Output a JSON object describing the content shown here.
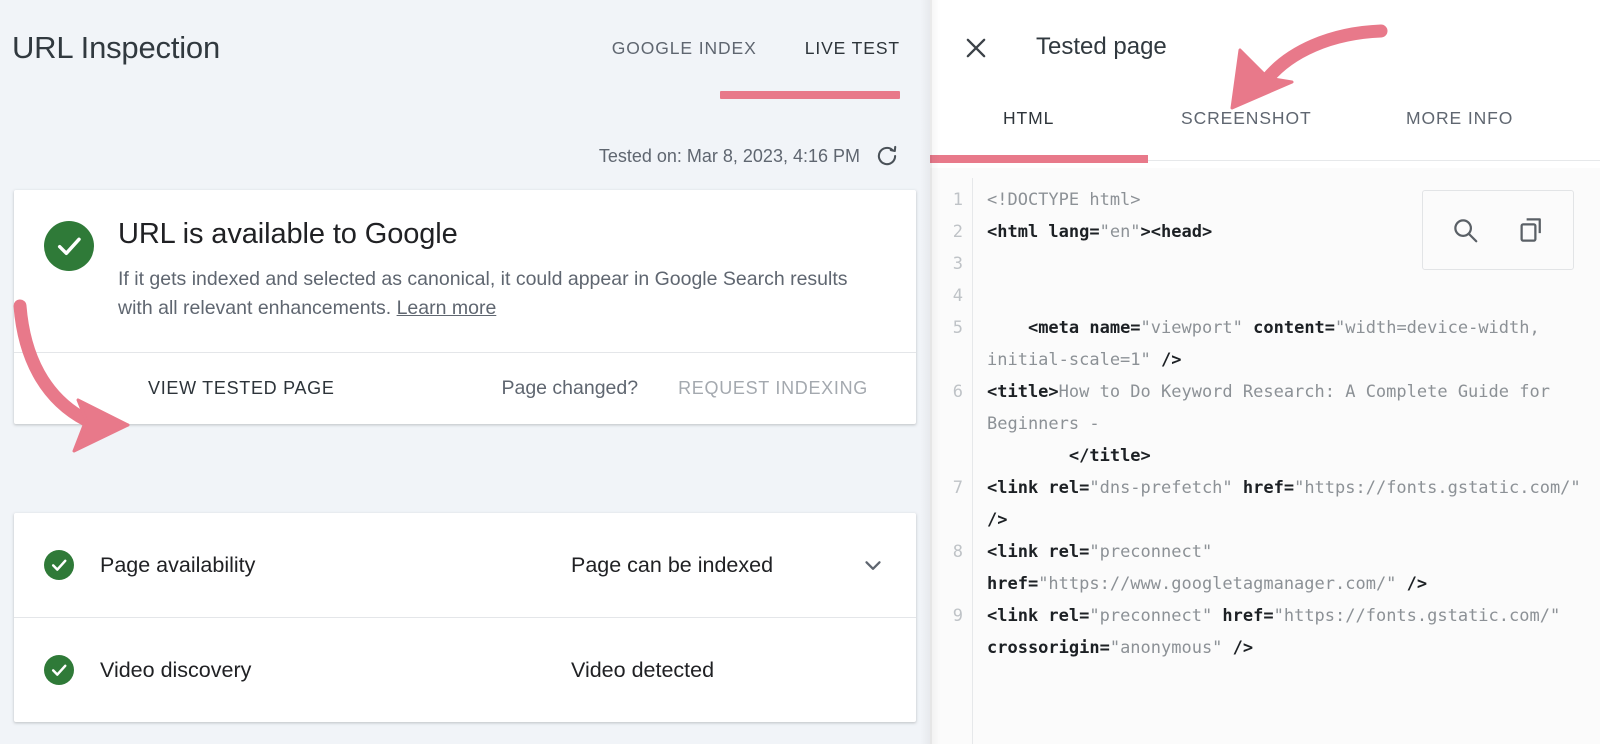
{
  "left": {
    "page_title": "URL Inspection",
    "tabs": [
      {
        "label": "GOOGLE INDEX",
        "active": false
      },
      {
        "label": "LIVE TEST",
        "active": true
      }
    ],
    "tested_on": "Tested on: Mar 8, 2023, 4:16 PM",
    "refresh_icon": "refresh-icon",
    "status_card": {
      "icon": "check-circle-icon",
      "title": "URL is available to Google",
      "description": "If it gets indexed and selected as canonical, it could appear in Google Search results with all relevant enhancements.",
      "learn_more": "Learn more",
      "view_tested_page": "VIEW TESTED PAGE",
      "page_changed": "Page changed?",
      "request_indexing": "REQUEST INDEXING"
    },
    "checks": [
      {
        "icon": "check-circle-icon",
        "label": "Page availability",
        "value": "Page can be indexed",
        "has_chevron": true,
        "chevron_icon": "chevron-down-icon"
      },
      {
        "icon": "check-circle-icon",
        "label": "Video discovery",
        "value": "Video detected",
        "has_chevron": false,
        "chevron_icon": ""
      }
    ]
  },
  "right": {
    "close_icon": "close-icon",
    "title": "Tested page",
    "tabs": [
      {
        "label": "HTML",
        "active": true
      },
      {
        "label": "SCREENSHOT",
        "active": false
      },
      {
        "label": "MORE INFO",
        "active": false
      }
    ],
    "tools": [
      {
        "icon": "search-icon"
      },
      {
        "icon": "copy-icon"
      }
    ],
    "line_numbers": [
      "1",
      "2",
      "3",
      "4",
      "5",
      "6",
      "7",
      "8",
      "9"
    ],
    "code_lines": [
      {
        "n": "1",
        "segments": [
          {
            "t": "plain",
            "s": "<!DOCTYPE html>"
          }
        ]
      },
      {
        "n": "2",
        "segments": [
          {
            "t": "tag",
            "s": "<html lang="
          },
          {
            "t": "plain",
            "s": "\"en\""
          },
          {
            "t": "tag",
            "s": "><head>"
          }
        ]
      },
      {
        "n": "3",
        "segments": [
          {
            "t": "plain",
            "s": ""
          }
        ]
      },
      {
        "n": "4",
        "segments": [
          {
            "t": "plain",
            "s": ""
          }
        ]
      },
      {
        "n": "5",
        "segments": [
          {
            "t": "tag",
            "s": "    <meta name="
          },
          {
            "t": "plain",
            "s": "\"viewport\" "
          },
          {
            "t": "tag",
            "s": "content="
          },
          {
            "t": "plain",
            "s": "\"width=device-width, initial-scale=1\" "
          },
          {
            "t": "tag",
            "s": "/>"
          }
        ]
      },
      {
        "n": "6",
        "segments": [
          {
            "t": "tag",
            "s": "<title>"
          },
          {
            "t": "plain",
            "s": "How to Do Keyword Research: A Complete Guide for Beginners -\n        "
          },
          {
            "t": "tag",
            "s": "</title>"
          }
        ]
      },
      {
        "n": "7",
        "segments": [
          {
            "t": "tag",
            "s": "<link rel="
          },
          {
            "t": "plain",
            "s": "\"dns-prefetch\" "
          },
          {
            "t": "tag",
            "s": "href="
          },
          {
            "t": "plain",
            "s": "\"https://fonts.gstatic.com/\" "
          },
          {
            "t": "tag",
            "s": "/>"
          }
        ]
      },
      {
        "n": "8",
        "segments": [
          {
            "t": "tag",
            "s": "<link rel="
          },
          {
            "t": "plain",
            "s": "\"preconnect\" "
          },
          {
            "t": "tag",
            "s": "href="
          },
          {
            "t": "plain",
            "s": "\"https://www.googletagmanager.com/\" "
          },
          {
            "t": "tag",
            "s": "/>"
          }
        ]
      },
      {
        "n": "9",
        "segments": [
          {
            "t": "tag",
            "s": "<link rel="
          },
          {
            "t": "plain",
            "s": "\"preconnect\" "
          },
          {
            "t": "tag",
            "s": "href="
          },
          {
            "t": "plain",
            "s": "\"https://fonts.gstatic.com/\" "
          },
          {
            "t": "tag",
            "s": "crossorigin="
          },
          {
            "t": "plain",
            "s": "\"anonymous\" "
          },
          {
            "t": "tag",
            "s": "/>"
          }
        ]
      }
    ]
  },
  "annotations": {
    "arrow_color": "#e8798a",
    "arrows": [
      {
        "name": "arrow-to-view-tested-page",
        "target": "VIEW TESTED PAGE"
      },
      {
        "name": "arrow-to-screenshot-tab",
        "target": "SCREENSHOT"
      }
    ]
  },
  "colors": {
    "accent_pink": "#e8798a",
    "success_green": "#2f7a38",
    "panel_bg": "#f1f4f8",
    "card_bg": "#ffffff",
    "code_bg": "#fbfbfb",
    "text_primary": "#202124",
    "text_secondary": "#5f6670",
    "text_disabled": "#a4a9af"
  }
}
